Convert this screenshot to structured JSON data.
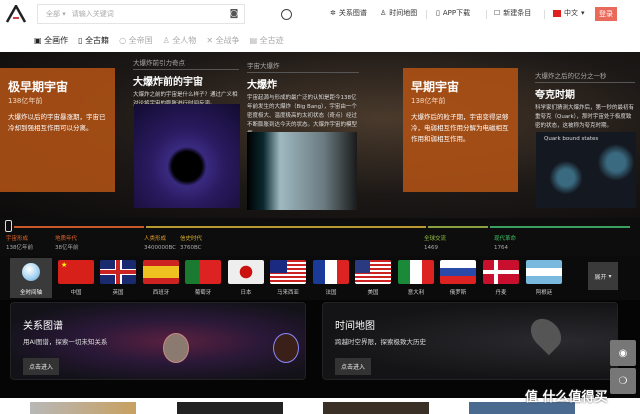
{
  "header": {
    "search_scope": "全部",
    "search_placeholder": "请输入关键词",
    "nav": [
      "关系图谱",
      "时间地图",
      "APP下载",
      "新建条目"
    ],
    "language": "中文",
    "login": "登录"
  },
  "categories": [
    "全画作",
    "全古籍",
    "全帝国",
    "全人物",
    "全战争",
    "全古迹"
  ],
  "hero": {
    "box1": {
      "title": "极早期宇宙",
      "sub": "138亿年前",
      "text": "大爆炸以后的宇宙暴涨期，宇宙已冷却到强相互作用可以分离。"
    },
    "art1": {
      "kicker": "大爆炸前引力奇点",
      "title": "大爆炸前的宇宙",
      "text": "大爆炸之前的宇宙是什么样子？通过广义相对论将宇宙的膨胀进行时间反演。"
    },
    "art2": {
      "kicker": "宇宙大爆炸",
      "title": "大爆炸",
      "text": "宇宙起源与形成的最广泛的认知是距今138亿年前发生的大爆炸（Big Bang），宇宙由一个密度极大、温度极高的太初状态（奇点）经过不断膨胀到达今天的状态。大爆炸宇宙的模型框"
    },
    "box2": {
      "title": "早期宇宙",
      "sub": "138亿年前",
      "text": "大爆炸后的粒子期，宇宙变得足够冷，电弱相互作用分解为电磁相互作用和弱相互作用。"
    },
    "art3": {
      "kicker": "大爆炸之后的亿分之一秒",
      "title": "夸克时期",
      "text": "科学家们猜测大爆炸后，第一秒的最初有重夸克（Quark），那时宇宙处于极度致密的状态，这被称为夸克时期。",
      "img_caption": "Quark bound states"
    }
  },
  "timeline": [
    {
      "label": "宇宙形成",
      "date": "138亿年前",
      "color": "#e0662a"
    },
    {
      "label": "地质年代",
      "date": "38亿年前",
      "color": "#e0662a"
    },
    {
      "label": "人类形成",
      "date": "3400000BC",
      "color": "#e09a2a"
    },
    {
      "label": "信史时代",
      "date": "3760BC",
      "color": "#d8b030"
    },
    {
      "label": "全球交流",
      "date": "1469",
      "color": "#8fc040"
    },
    {
      "label": "现代革命",
      "date": "1764",
      "color": "#3cc060"
    }
  ],
  "countries": {
    "global": "全时间轴",
    "items": [
      "中国",
      "英国",
      "西班牙",
      "葡萄牙",
      "日本",
      "马来西亚",
      "法国",
      "美国",
      "意大利",
      "俄罗斯",
      "丹麦",
      "阿根廷"
    ],
    "expand": "展开"
  },
  "cards": [
    {
      "title": "关系图谱",
      "desc": "用AI图谱，探索一切未知关系",
      "button": "点击进入"
    },
    {
      "title": "时间地图",
      "desc": "跨越时空界限，探索极致大历史",
      "button": "点击进入"
    }
  ],
  "watermark": "值 什么值得买"
}
